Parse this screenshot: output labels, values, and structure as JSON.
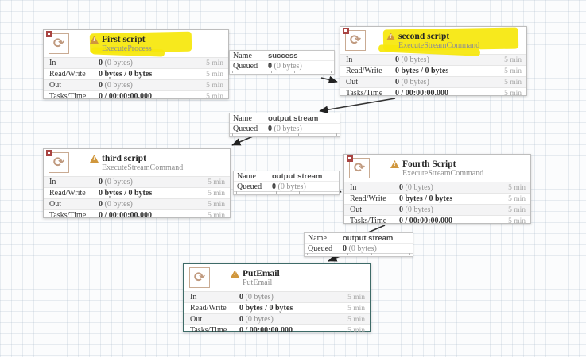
{
  "colors": {
    "highlight": "#f6e70a",
    "warning": "#d0973d",
    "stopped": "#a94442",
    "selection": "#3e6b68",
    "icon": "#c09a7f",
    "arrow": "#333333"
  },
  "icons": {
    "processor_glyph": "⟳",
    "warning_mark": "!"
  },
  "processors": [
    {
      "title": "First script",
      "type": "ExecuteProcess",
      "highlighted": true,
      "selected": false,
      "stats": [
        {
          "label": "In",
          "bold": "0",
          "rest": "(0 bytes)",
          "window": "5 min"
        },
        {
          "label": "Read/Write",
          "bold": "0 bytes / 0 bytes",
          "rest": "",
          "window": "5 min"
        },
        {
          "label": "Out",
          "bold": "0",
          "rest": "(0 bytes)",
          "window": "5 min"
        },
        {
          "label": "Tasks/Time",
          "bold": "0 / 00:00:00.000",
          "rest": "",
          "window": "5 min"
        }
      ]
    },
    {
      "title": "second script",
      "type": "ExecuteStreamCommand",
      "highlighted": true,
      "selected": false,
      "stats": [
        {
          "label": "In",
          "bold": "0",
          "rest": "(0 bytes)",
          "window": "5 min"
        },
        {
          "label": "Read/Write",
          "bold": "0 bytes / 0 bytes",
          "rest": "",
          "window": "5 min"
        },
        {
          "label": "Out",
          "bold": "0",
          "rest": "(0 bytes)",
          "window": "5 min"
        },
        {
          "label": "Tasks/Time",
          "bold": "0 / 00:00:00.000",
          "rest": "",
          "window": "5 min"
        }
      ]
    },
    {
      "title": "third script",
      "type": "ExecuteStreamCommand",
      "highlighted": false,
      "selected": false,
      "stats": [
        {
          "label": "In",
          "bold": "0",
          "rest": "(0 bytes)",
          "window": "5 min"
        },
        {
          "label": "Read/Write",
          "bold": "0 bytes / 0 bytes",
          "rest": "",
          "window": "5 min"
        },
        {
          "label": "Out",
          "bold": "0",
          "rest": "(0 bytes)",
          "window": "5 min"
        },
        {
          "label": "Tasks/Time",
          "bold": "0 / 00:00:00.000",
          "rest": "",
          "window": "5 min"
        }
      ]
    },
    {
      "title": "Fourth Script",
      "type": "ExecuteStreamCommand",
      "highlighted": false,
      "selected": false,
      "stats": [
        {
          "label": "In",
          "bold": "0",
          "rest": "(0 bytes)",
          "window": "5 min"
        },
        {
          "label": "Read/Write",
          "bold": "0 bytes / 0 bytes",
          "rest": "",
          "window": "5 min"
        },
        {
          "label": "Out",
          "bold": "0",
          "rest": "(0 bytes)",
          "window": "5 min"
        },
        {
          "label": "Tasks/Time",
          "bold": "0 / 00:00:00.000",
          "rest": "",
          "window": "5 min"
        }
      ]
    },
    {
      "title": "PutEmail",
      "type": "PutEmail",
      "highlighted": false,
      "selected": true,
      "stats": [
        {
          "label": "In",
          "bold": "0",
          "rest": "(0 bytes)",
          "window": "5 min"
        },
        {
          "label": "Read/Write",
          "bold": "0 bytes / 0 bytes",
          "rest": "",
          "window": "5 min"
        },
        {
          "label": "Out",
          "bold": "0",
          "rest": "(0 bytes)",
          "window": "5 min"
        },
        {
          "label": "Tasks/Time",
          "bold": "0 / 00:00:00.000",
          "rest": "",
          "window": "5 min"
        }
      ]
    }
  ],
  "connections": [
    {
      "name_label": "Name",
      "name_value": "success",
      "queued_label": "Queued",
      "queued_bold": "0",
      "queued_rest": "(0 bytes)"
    },
    {
      "name_label": "Name",
      "name_value": "output stream",
      "queued_label": "Queued",
      "queued_bold": "0",
      "queued_rest": "(0 bytes)"
    },
    {
      "name_label": "Name",
      "name_value": "output stream",
      "queued_label": "Queued",
      "queued_bold": "0",
      "queued_rest": "(0 bytes)"
    },
    {
      "name_label": "Name",
      "name_value": "output stream",
      "queued_label": "Queued",
      "queued_bold": "0",
      "queued_rest": "(0 bytes)"
    }
  ]
}
